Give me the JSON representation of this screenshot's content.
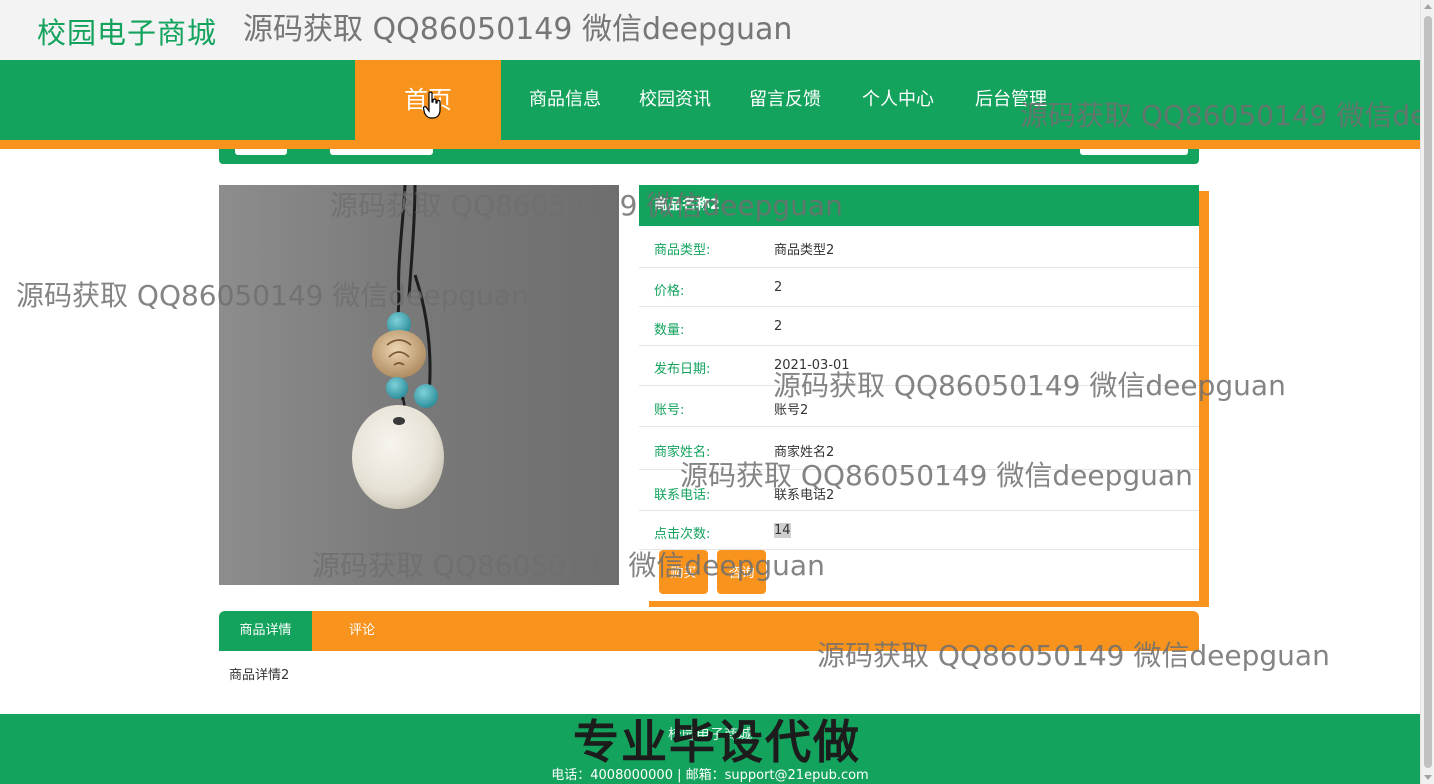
{
  "header": {
    "site_title": "校园电子商城"
  },
  "nav": {
    "items": [
      {
        "label": "首页",
        "active": true
      },
      {
        "label": "商品信息"
      },
      {
        "label": "校园资讯"
      },
      {
        "label": "留言反馈"
      },
      {
        "label": "个人中心"
      },
      {
        "label": "后台管理"
      }
    ]
  },
  "product": {
    "name": "商品名称2",
    "image_alt": "pendant necklace",
    "fields": [
      {
        "label": "商品类型:",
        "value": "商品类型2"
      },
      {
        "label": "价格:",
        "value": "2"
      },
      {
        "label": "数量:",
        "value": "2"
      },
      {
        "label": "发布日期:",
        "value": "2021-03-01"
      },
      {
        "label": "账号:",
        "value": "账号2"
      },
      {
        "label": "商家姓名:",
        "value": "商家姓名2"
      },
      {
        "label": "联系电话:",
        "value": "联系电话2"
      },
      {
        "label": "点击次数:",
        "value": "14"
      }
    ],
    "buy_label": "购买",
    "consult_label": "咨询"
  },
  "tabs": {
    "items": [
      {
        "label": "商品详情",
        "active": true
      },
      {
        "label": "评论"
      }
    ],
    "content": "商品详情2"
  },
  "footer": {
    "title": "校园电子商城",
    "contact": "电话：4008000000 | 邮箱：support@21epub.com",
    "promo": "专业毕设代做"
  },
  "watermark": "源码获取 QQ86050149 微信deepguan",
  "colors": {
    "green": "#13a35d",
    "orange": "#f8941d"
  }
}
